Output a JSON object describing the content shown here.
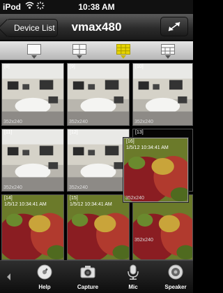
{
  "status": {
    "carrier": "iPod",
    "time": "10:38 AM"
  },
  "nav": {
    "back_label": "Device List",
    "title": "vmax480"
  },
  "layouts": [
    {
      "name": "single",
      "icon": "single-view-icon"
    },
    {
      "name": "quad",
      "icon": "quad-view-icon"
    },
    {
      "name": "nine",
      "icon": "nine-view-icon",
      "active": true
    },
    {
      "name": "custom",
      "icon": "custom-view-icon"
    }
  ],
  "tiles": [
    {
      "index": "[8]",
      "res": "352x240",
      "timestamp": "",
      "scene": "office"
    },
    {
      "index": "[9]",
      "res": "352x240",
      "timestamp": "",
      "scene": "office"
    },
    {
      "index": "[10]",
      "res": "352x240",
      "timestamp": "",
      "scene": "office"
    },
    {
      "index": "[11]",
      "res": "352x240",
      "timestamp": "",
      "scene": "office"
    },
    {
      "index": "[12]",
      "res": "352x240",
      "timestamp": "",
      "scene": "office"
    },
    {
      "index": "[13]",
      "res": "352x240",
      "timestamp": "",
      "scene": "dark"
    },
    {
      "index": "[14]",
      "res": "352x240",
      "timestamp": "1/5/12 10:34:41 AM",
      "scene": "apple"
    },
    {
      "index": "[15]",
      "res": "352x240",
      "timestamp": "1/5/12 10:34:41 AM",
      "scene": "apple"
    },
    {
      "index": "",
      "res": "352x240",
      "timestamp": "",
      "scene": "apple"
    },
    {
      "index": "[16]",
      "res": "352x240",
      "timestamp": "1/5/12 10:34:41 AM",
      "scene": "apple"
    }
  ],
  "tabs": [
    {
      "label": "Help",
      "icon": "help-icon"
    },
    {
      "label": "Capture",
      "icon": "camera-icon"
    },
    {
      "label": "Mic",
      "icon": "microphone-icon"
    },
    {
      "label": "Speaker",
      "icon": "speaker-icon"
    }
  ],
  "colors": {
    "accent_yellow": "#e6d400",
    "tile_border": "#555555"
  }
}
